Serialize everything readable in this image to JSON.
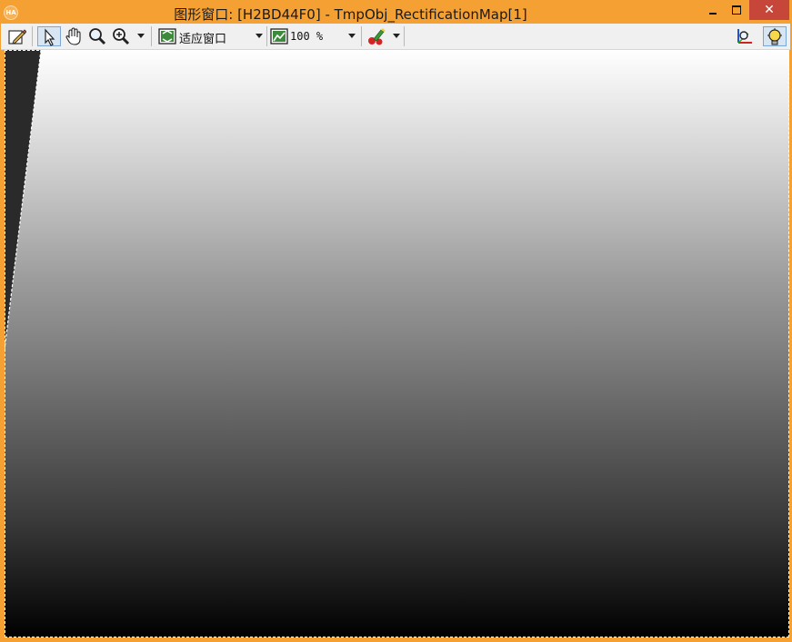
{
  "window": {
    "title": "图形窗口: [H2BD44F0] - TmpObj_RectificationMap[1]",
    "app_icon_text": "HA",
    "minimize_icon": "minimize-icon",
    "maximize_icon": "maximize-icon",
    "close_label": "✕"
  },
  "toolbar": {
    "tools": [
      "edit-icon",
      "pointer-icon",
      "hand-pan-icon",
      "magnifier-icon",
      "zoom-in-icon"
    ],
    "fit_mode": "适应窗口",
    "zoom": "100 %",
    "right_icons": [
      "axes-pick-icon",
      "lightbulb-icon"
    ]
  },
  "colors": {
    "title_bar": "#f5a033",
    "close_button": "#c7463a",
    "toolbar": "#f0f0f0",
    "image_top": "#ffffff",
    "image_bottom": "#000000"
  }
}
